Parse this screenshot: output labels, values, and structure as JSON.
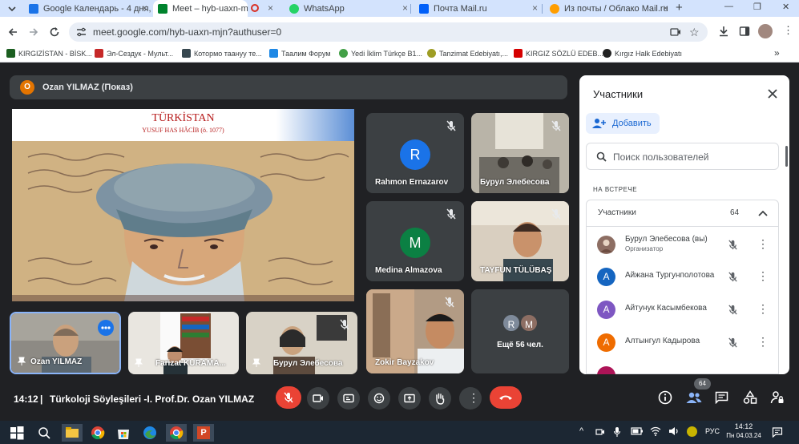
{
  "browser": {
    "tabs": [
      {
        "title": "Google Календарь - 4 дня, с",
        "close": "×",
        "color": "#1a73e8"
      },
      {
        "title": "Meet – hyb-uaxn-mjn",
        "close": "×",
        "color": "#00832d"
      },
      {
        "title": "WhatsApp",
        "close": "×",
        "color": "#25d366"
      },
      {
        "title": "Почта Mail.ru",
        "close": "×",
        "color": "#005ff9"
      },
      {
        "title": "Из почты / Облако Mail.ru",
        "close": "×",
        "color": "#ff9e00"
      }
    ],
    "new_tab": "+",
    "window_controls": {
      "minimize": "—",
      "restore": "❐",
      "close": "✕"
    },
    "url": "meet.google.com/hyb-uaxn-mjn?authuser=0",
    "bookmarks": [
      "KIRGIZİSTAN - BİSK...",
      "Эл-Сездук - Мульт...",
      "Котормо таануу те...",
      "Таалим Форум",
      "Yedi İklim Türkçe B1...",
      "Tanzimat Edebiyatı,...",
      "KIRGIZ SÖZLÜ EDEB...",
      "Kırgız Halk Edebiyatı"
    ],
    "bookmarks_more": "»"
  },
  "meet": {
    "presenter_badge": "O",
    "presenter_label": "Ozan YILMAZ (Показ)",
    "slide": {
      "title": "TÜRKİSTAN",
      "subtitle": "YUSUF HAS HÂCİB (ö. 1077)"
    },
    "tiles": [
      {
        "name": "Rahmon Ernazarov",
        "initial": "R",
        "color": "#1a73e8"
      },
      {
        "name": "Бурул Элебесова"
      },
      {
        "name": "Medina Almazova",
        "initial": "M",
        "color": "#0b8043"
      },
      {
        "name": "TAYFUN TÜLÜBAŞ"
      },
      {
        "name": "Zokir Bayzakov"
      },
      {
        "name": "Ещё 56 чел.",
        "initials": [
          "R",
          "M"
        ]
      }
    ],
    "bottom_tiles": [
      {
        "name": "Ozan YILMAZ"
      },
      {
        "name": "Farizat KURAMA..."
      },
      {
        "name": "Бурул Элебесова"
      }
    ],
    "time": "14:12",
    "title": "Türkoloji Söyleşileri -I. Prof.Dr. Ozan YILMAZ",
    "participant_count_badge": "64"
  },
  "panel": {
    "title": "Участники",
    "add_label": "Добавить",
    "search_placeholder": "Поиск пользователей",
    "section_label": "НА ВСТРЕЧЕ",
    "group_label": "Участники",
    "group_count": "64",
    "participants": [
      {
        "name": "Бурул Элебесова (вы)",
        "role": "Организатор",
        "initial": "",
        "color": "#8d6e63"
      },
      {
        "name": "Айжана Тургунполотова",
        "initial": "А",
        "color": "#1565c0"
      },
      {
        "name": "Айтунук Касымбекова",
        "initial": "А",
        "color": "#7e57c2"
      },
      {
        "name": "Алтынгул Кадырова",
        "initial": "А",
        "color": "#ef6c00"
      }
    ]
  },
  "taskbar": {
    "lang": "РУС",
    "time": "14:12",
    "date": "Пн 04.03.24",
    "pinned_labels": [
      "P"
    ]
  },
  "colors": {
    "hangup": "#ea4335",
    "mic_off": "#ea4335",
    "accent": "#1a73e8"
  }
}
